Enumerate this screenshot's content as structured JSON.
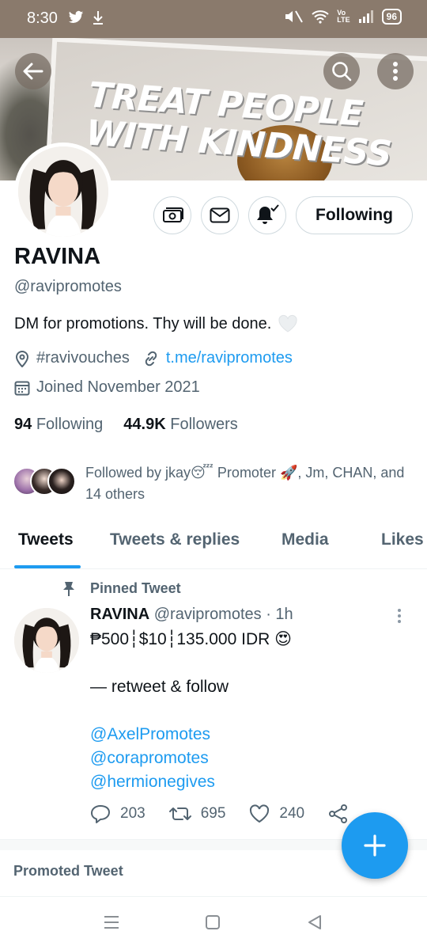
{
  "status": {
    "time": "8:30",
    "battery": "96",
    "network_label": "Vo\nLTE"
  },
  "banner": {
    "line1": "TREAT PEOPLE",
    "line2": "WITH KINDNESS"
  },
  "profile": {
    "name": "RAVINA",
    "handle": "@ravipromotes",
    "bio": "DM for promotions. Thy will be done.",
    "location": "#ravivouches",
    "website": "t.me/ravipromotes",
    "joined": "Joined November 2021",
    "following_count": "94",
    "following_label": "Following",
    "followers_count": "44.9K",
    "followers_label": "Followers",
    "followed_by": "Followed by jkay😴 Promoter 🚀, Jm, CHAN, and 14 others"
  },
  "actions": {
    "following_button": "Following"
  },
  "tabs": [
    "Tweets",
    "Tweets & replies",
    "Media",
    "Likes"
  ],
  "tweet": {
    "pinned_label": "Pinned Tweet",
    "author": "RAVINA",
    "handle_time": "@ravipromotes · 1h",
    "line1": "₱500┆$10┆135.000 IDR 😍",
    "line2": "— retweet & follow",
    "mentions": [
      "@AxelPromotes",
      "@corapromotes",
      "@hermionegives"
    ],
    "replies": "203",
    "retweets": "695",
    "likes": "240"
  },
  "promoted_label": "Promoted Tweet",
  "colors": {
    "accent": "#1d9bf0",
    "text": "#0f1419",
    "secondary": "#536471",
    "status_bar": "#8a7a6c"
  }
}
